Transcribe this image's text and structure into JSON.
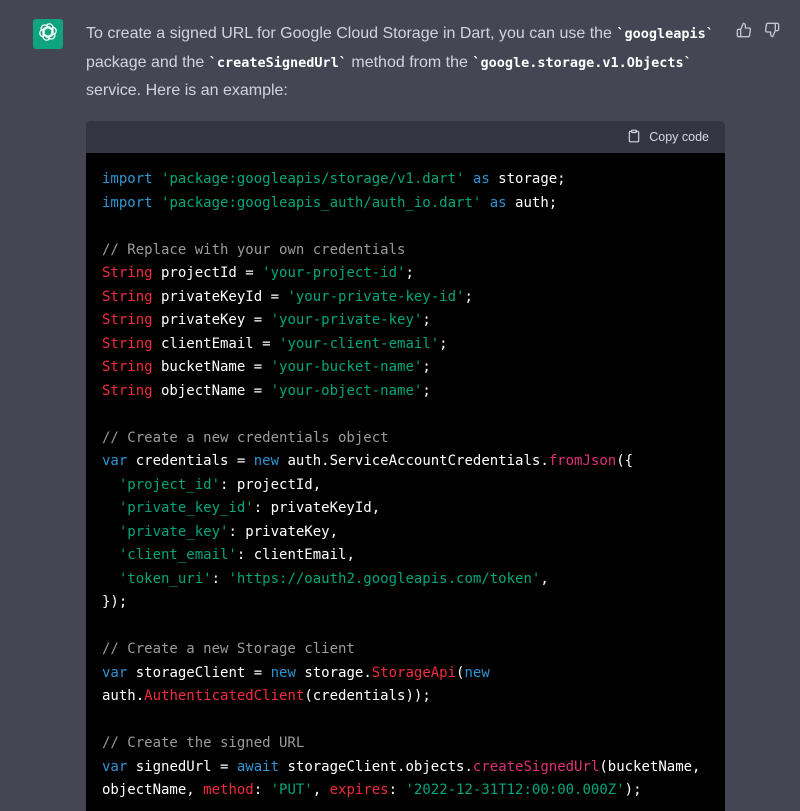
{
  "assistant": {
    "avatar_icon": "openai-logo-icon",
    "feedback": {
      "thumbs_up_icon": "thumbs-up-icon",
      "thumbs_down_icon": "thumbs-down-icon"
    }
  },
  "message": {
    "intro": {
      "part1": "To create a signed URL for Google Cloud Storage in Dart, you can use the ",
      "code1": "`googleapis`",
      "part2": " package and the ",
      "code2": "`createSignedUrl`",
      "part3": " method from the ",
      "code3": "`google.storage.v1.Objects`",
      "part4": " service. Here is an example:"
    }
  },
  "code_block": {
    "copy_label": "Copy code",
    "copy_icon": "clipboard-icon",
    "colors": {
      "background": "#000000",
      "header": "#343541",
      "keyword": "#2e95d3",
      "string": "#00a67d",
      "type": "#f22c3d",
      "function": "#df3079",
      "comment": "#9b9b9b"
    },
    "lines": [
      [
        [
          "kw",
          "import"
        ],
        [
          "pl",
          " "
        ],
        [
          "str",
          "'package:googleapis/storage/v1.dart'"
        ],
        [
          "pl",
          " "
        ],
        [
          "kw",
          "as"
        ],
        [
          "pl",
          " storage;"
        ]
      ],
      [
        [
          "kw",
          "import"
        ],
        [
          "pl",
          " "
        ],
        [
          "str",
          "'package:googleapis_auth/auth_io.dart'"
        ],
        [
          "pl",
          " "
        ],
        [
          "kw",
          "as"
        ],
        [
          "pl",
          " auth;"
        ]
      ],
      [],
      [
        [
          "cmt",
          "// Replace with your own credentials"
        ]
      ],
      [
        [
          "typ",
          "String"
        ],
        [
          "pl",
          " projectId = "
        ],
        [
          "str",
          "'your-project-id'"
        ],
        [
          "pl",
          ";"
        ]
      ],
      [
        [
          "typ",
          "String"
        ],
        [
          "pl",
          " privateKeyId = "
        ],
        [
          "str",
          "'your-private-key-id'"
        ],
        [
          "pl",
          ";"
        ]
      ],
      [
        [
          "typ",
          "String"
        ],
        [
          "pl",
          " privateKey = "
        ],
        [
          "str",
          "'your-private-key'"
        ],
        [
          "pl",
          ";"
        ]
      ],
      [
        [
          "typ",
          "String"
        ],
        [
          "pl",
          " clientEmail = "
        ],
        [
          "str",
          "'your-client-email'"
        ],
        [
          "pl",
          ";"
        ]
      ],
      [
        [
          "typ",
          "String"
        ],
        [
          "pl",
          " bucketName = "
        ],
        [
          "str",
          "'your-bucket-name'"
        ],
        [
          "pl",
          ";"
        ]
      ],
      [
        [
          "typ",
          "String"
        ],
        [
          "pl",
          " objectName = "
        ],
        [
          "str",
          "'your-object-name'"
        ],
        [
          "pl",
          ";"
        ]
      ],
      [],
      [
        [
          "cmt",
          "// Create a new credentials object"
        ]
      ],
      [
        [
          "kw",
          "var"
        ],
        [
          "pl",
          " credentials = "
        ],
        [
          "kw",
          "new"
        ],
        [
          "pl",
          " auth.ServiceAccountCredentials."
        ],
        [
          "fn",
          "fromJson"
        ],
        [
          "pl",
          "({"
        ]
      ],
      [
        [
          "pl",
          "  "
        ],
        [
          "str",
          "'project_id'"
        ],
        [
          "pl",
          ": projectId,"
        ]
      ],
      [
        [
          "pl",
          "  "
        ],
        [
          "str",
          "'private_key_id'"
        ],
        [
          "pl",
          ": privateKeyId,"
        ]
      ],
      [
        [
          "pl",
          "  "
        ],
        [
          "str",
          "'private_key'"
        ],
        [
          "pl",
          ": privateKey,"
        ]
      ],
      [
        [
          "pl",
          "  "
        ],
        [
          "str",
          "'client_email'"
        ],
        [
          "pl",
          ": clientEmail,"
        ]
      ],
      [
        [
          "pl",
          "  "
        ],
        [
          "str",
          "'token_uri'"
        ],
        [
          "pl",
          ": "
        ],
        [
          "str",
          "'https://oauth2.googleapis.com/token'"
        ],
        [
          "pl",
          ","
        ]
      ],
      [
        [
          "pl",
          "});"
        ]
      ],
      [],
      [
        [
          "cmt",
          "// Create a new Storage client"
        ]
      ],
      [
        [
          "kw",
          "var"
        ],
        [
          "pl",
          " storageClient = "
        ],
        [
          "kw",
          "new"
        ],
        [
          "pl",
          " storage."
        ],
        [
          "typ",
          "StorageApi"
        ],
        [
          "pl",
          "("
        ],
        [
          "kw",
          "new"
        ]
      ],
      [
        [
          "pl",
          "auth."
        ],
        [
          "typ",
          "AuthenticatedClient"
        ],
        [
          "pl",
          "(credentials));"
        ]
      ],
      [],
      [
        [
          "cmt",
          "// Create the signed URL"
        ]
      ],
      [
        [
          "kw",
          "var"
        ],
        [
          "pl",
          " signedUrl = "
        ],
        [
          "kw",
          "await"
        ],
        [
          "pl",
          " storageClient.objects."
        ],
        [
          "fn",
          "createSignedUrl"
        ],
        [
          "pl",
          "(bucketName,"
        ]
      ],
      [
        [
          "pl",
          "objectName, "
        ],
        [
          "typ",
          "method"
        ],
        [
          "pl",
          ": "
        ],
        [
          "str",
          "'PUT'"
        ],
        [
          "pl",
          ", "
        ],
        [
          "typ",
          "expires"
        ],
        [
          "pl",
          ": "
        ],
        [
          "str",
          "'2022-12-31T12:00:00.000Z'"
        ],
        [
          "pl",
          ");"
        ]
      ]
    ]
  }
}
